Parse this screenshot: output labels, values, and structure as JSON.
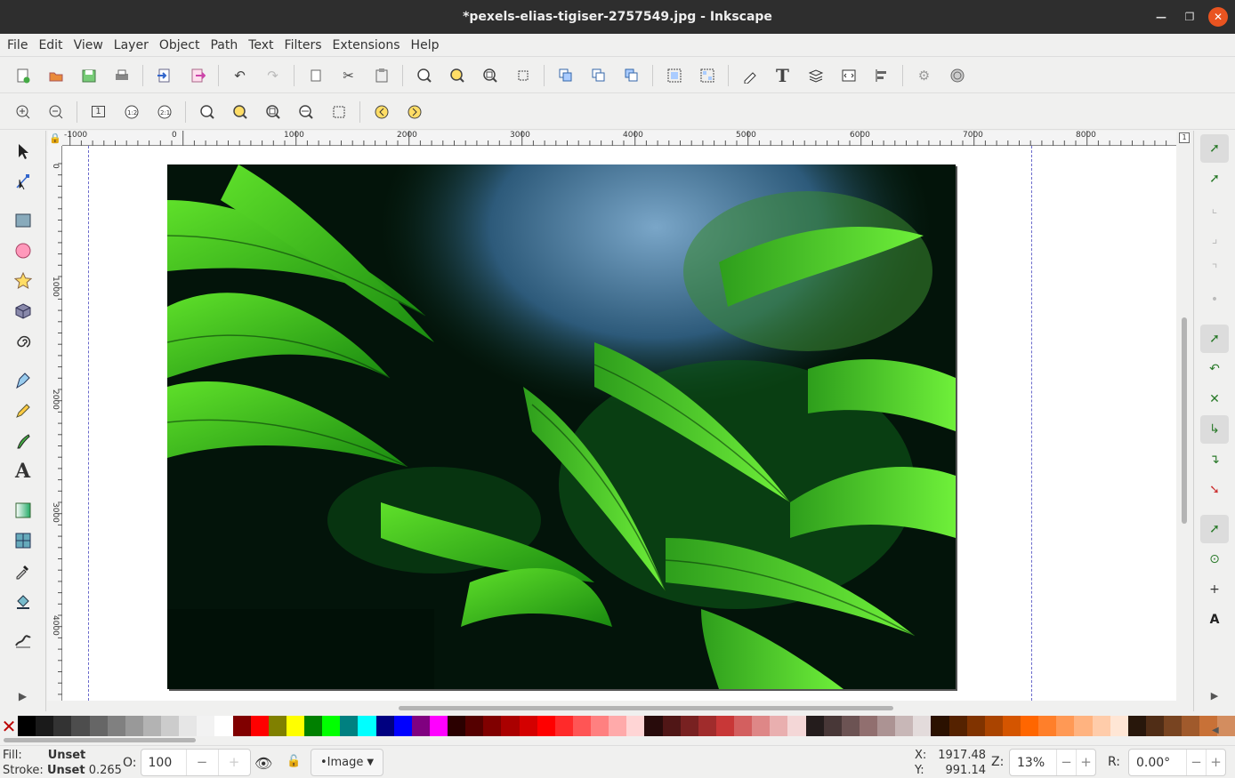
{
  "window": {
    "title": "*pexels-elias-tigiser-2757549.jpg - Inkscape"
  },
  "menu": [
    "File",
    "Edit",
    "View",
    "Layer",
    "Object",
    "Path",
    "Text",
    "Filters",
    "Extensions",
    "Help"
  ],
  "ruler": {
    "h_labels": [
      "-1000",
      "0",
      "1000",
      "2000",
      "3000",
      "4000",
      "5000",
      "6000",
      "7000",
      "8000"
    ],
    "v_labels": [
      "0",
      "1000",
      "2000",
      "3000",
      "4000"
    ]
  },
  "photo": {
    "description_icon": "image-icon",
    "filename": "pexels-elias-tigiser-2757549.jpg"
  },
  "status": {
    "fill_label": "Fill:",
    "fill_value": "Unset",
    "stroke_label": "Stroke:",
    "stroke_value": "Unset",
    "stroke_width": "0.265",
    "opacity_label": "O:",
    "opacity_value": "100",
    "layer": "•Image",
    "x_label": "X:",
    "x_value": "1917.48",
    "y_label": "Y:",
    "y_value": "991.14",
    "zoom_label": "Z:",
    "zoom_value": "13%",
    "rotation_label": "R:",
    "rotation_value": "0.00°"
  },
  "palette": [
    "#000000",
    "#1a1a1a",
    "#333333",
    "#4d4d4d",
    "#666666",
    "#808080",
    "#999999",
    "#b3b3b3",
    "#cccccc",
    "#e6e6e6",
    "#f2f2f2",
    "#ffffff",
    "#800000",
    "#ff0000",
    "#808000",
    "#ffff00",
    "#008000",
    "#00ff00",
    "#008080",
    "#00ffff",
    "#000080",
    "#0000ff",
    "#800080",
    "#ff00ff",
    "#2b0000",
    "#550000",
    "#800000",
    "#aa0000",
    "#d40000",
    "#ff0000",
    "#ff2a2a",
    "#ff5555",
    "#ff8080",
    "#ffaaaa",
    "#ffd5d5",
    "#280b0b",
    "#501616",
    "#782121",
    "#a02c2c",
    "#c83737",
    "#d35f5f",
    "#de8787",
    "#e9afaf",
    "#f4d7d7",
    "#241c1c",
    "#483737",
    "#6c5353",
    "#916f6f",
    "#ac9393",
    "#c8b7b7",
    "#e3dbdb",
    "#2b1100",
    "#552200",
    "#803300",
    "#aa4400",
    "#d45500",
    "#ff6600",
    "#ff7f2a",
    "#ff9955",
    "#ffb380",
    "#ffccaa",
    "#ffe6d5",
    "#28170b",
    "#502d16",
    "#784421",
    "#a05a2c",
    "#c87137",
    "#d38d5f"
  ]
}
